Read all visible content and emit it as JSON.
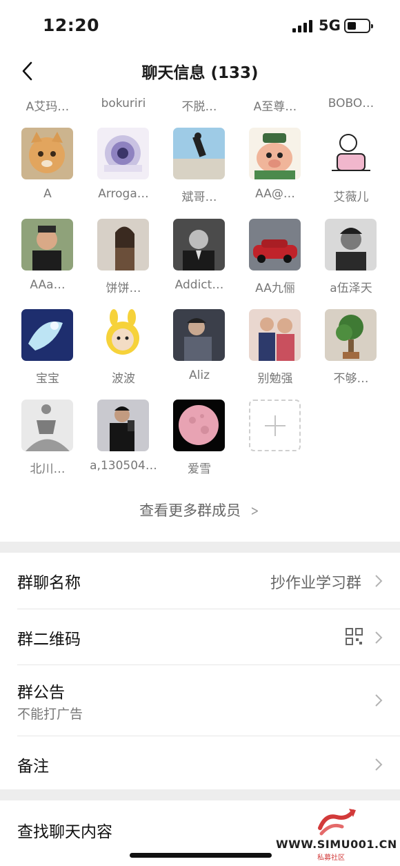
{
  "status_bar": {
    "time": "12:20",
    "network": "5G"
  },
  "nav": {
    "title": "聊天信息 (133)"
  },
  "members": {
    "top_names": [
      "A艾玛…",
      "bokuriri",
      "不脱…",
      "A至尊…",
      "BOBO…"
    ],
    "rows": [
      [
        "A",
        "Arroga…",
        "斌哥…",
        "AA@…",
        "艾薇儿"
      ],
      [
        "AAa…",
        "饼饼…",
        "Addict…",
        "AA九俪",
        "a伍泽天"
      ],
      [
        "宝宝",
        "波波",
        "Aliz",
        "别勉强",
        "不够…"
      ],
      [
        "北川…",
        "a,130504…",
        "爱雪"
      ]
    ],
    "more_label": "查看更多群成员"
  },
  "settings": {
    "group_name_label": "群聊名称",
    "group_name_value": "抄作业学习群",
    "qrcode_label": "群二维码",
    "notice_label": "群公告",
    "notice_value": "不能打广告",
    "remark_label": "备注",
    "search_label": "查找聊天内容"
  },
  "watermark": {
    "text": "WWW.SIMU001.CN",
    "sub": "私募社区"
  },
  "colors": {
    "background": "#ededed",
    "text": "#1a1a1a",
    "secondary": "#777777",
    "watermark_red": "#d23a3a"
  }
}
